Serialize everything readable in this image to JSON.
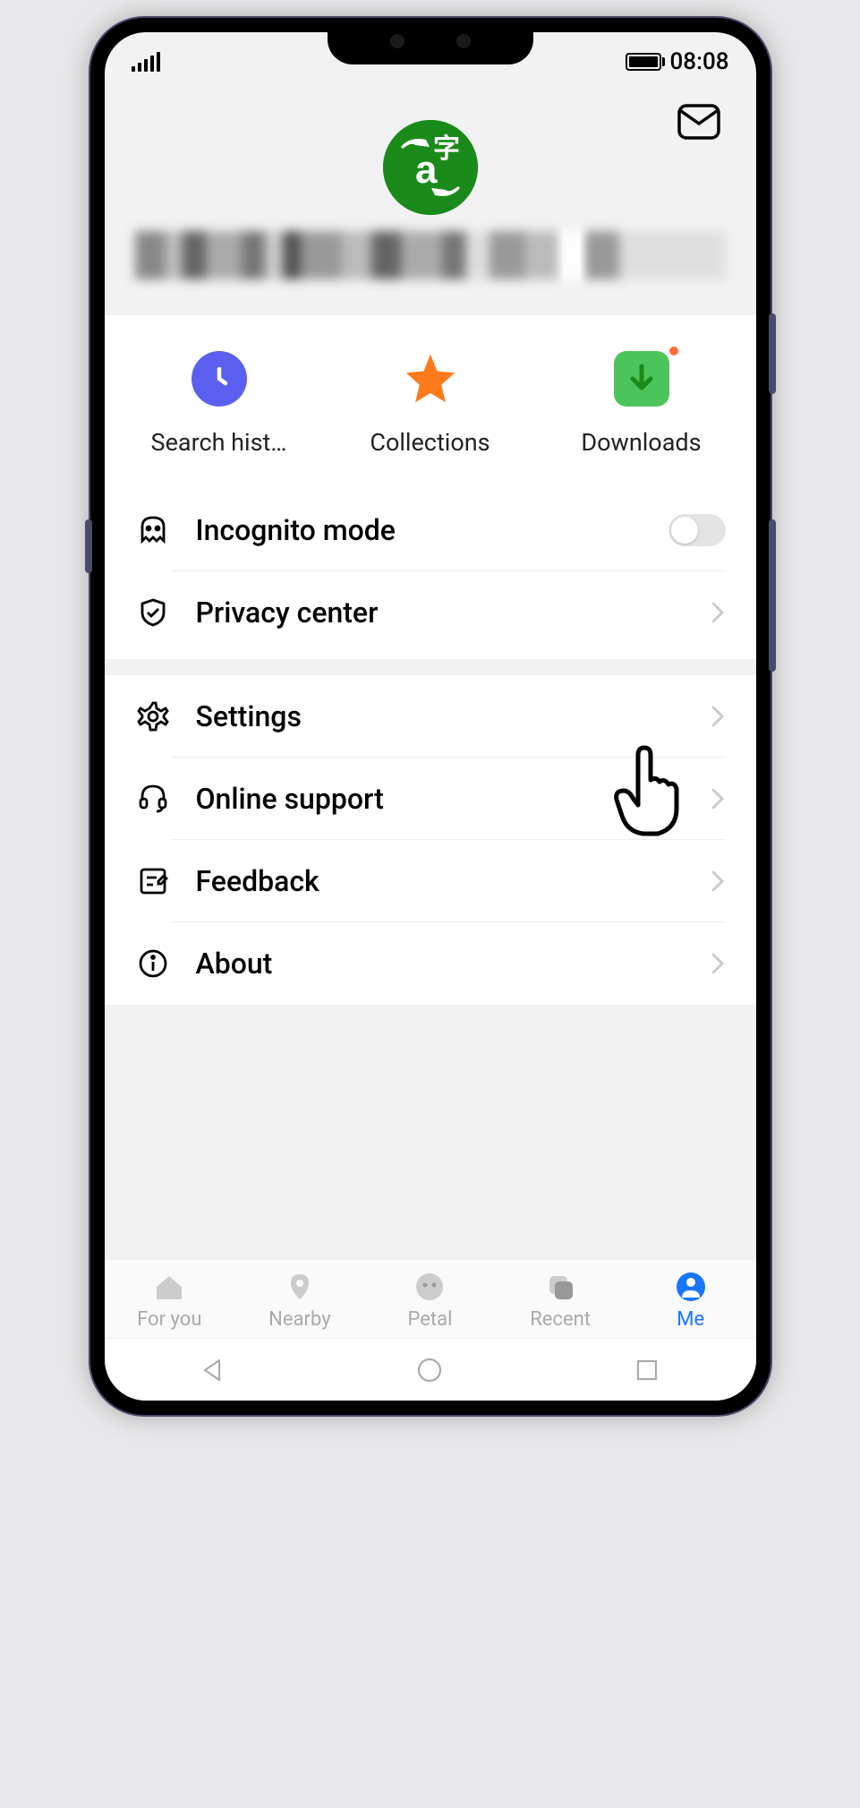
{
  "statusbar": {
    "time": "08:08"
  },
  "header": {
    "username_redacted": true
  },
  "quick": {
    "history_label": "Search hist…",
    "collections_label": "Collections",
    "downloads_label": "Downloads",
    "downloads_badge": true
  },
  "menu": {
    "incognito": {
      "label": "Incognito mode",
      "on": false
    },
    "privacy": {
      "label": "Privacy center"
    },
    "settings": {
      "label": "Settings"
    },
    "support": {
      "label": "Online support"
    },
    "feedback": {
      "label": "Feedback"
    },
    "about": {
      "label": "About"
    }
  },
  "tabs": {
    "foryou": "For you",
    "nearby": "Nearby",
    "petal": "Petal",
    "recent": "Recent",
    "me": "Me"
  }
}
